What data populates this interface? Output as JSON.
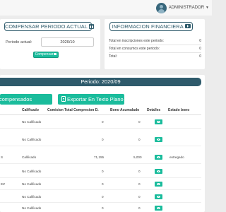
{
  "header": {
    "user_name": "ADMINISTRADOR"
  },
  "compensar": {
    "title": "COMPENSAR PERIODO ACTUAL",
    "period_label": "Periodo actual:",
    "period_value": "2020/10",
    "button_label": "Compensar"
  },
  "financiera": {
    "title": "INFORMACION FINANCIERA",
    "rows": [
      {
        "label": "Total en inscripciones este periodo:",
        "value": "0"
      },
      {
        "label": "Total en consumos este periodo:",
        "value": "0"
      },
      {
        "label": "Total:",
        "value": "0"
      }
    ]
  },
  "period_bar": {
    "label": "Periodo: 2020/09"
  },
  "actions": {
    "compensados_label": "compensados",
    "export_label": "Exportar En Texto Plano"
  },
  "table": {
    "headers": [
      "Calificado",
      "Comision Total Compresion D.",
      "Bono Acumulado",
      "Detalles",
      "Estado bono"
    ],
    "rows": [
      {
        "frag": "",
        "calificado": "No Calificado",
        "comision": "0",
        "bono": "0",
        "estado": ""
      },
      {
        "frag": "",
        "calificado": "No Calificado",
        "comision": "0",
        "bono": "0",
        "estado": ""
      },
      {
        "frag": "S",
        "calificado": "Calificado",
        "comision": "71,155",
        "bono": "5,000",
        "estado": "entregado"
      },
      {
        "frag": "",
        "calificado": "No Calificado",
        "comision": "0",
        "bono": "0",
        "estado": ""
      },
      {
        "frag": "EZ",
        "calificado": "No Calificado",
        "comision": "0",
        "bono": "0",
        "estado": ""
      },
      {
        "frag": "",
        "calificado": "No Calificado",
        "comision": "0",
        "bono": "0",
        "estado": ""
      },
      {
        "frag": "",
        "calificado": "No Calificado",
        "comision": "0",
        "bono": "0",
        "estado": ""
      }
    ]
  }
}
